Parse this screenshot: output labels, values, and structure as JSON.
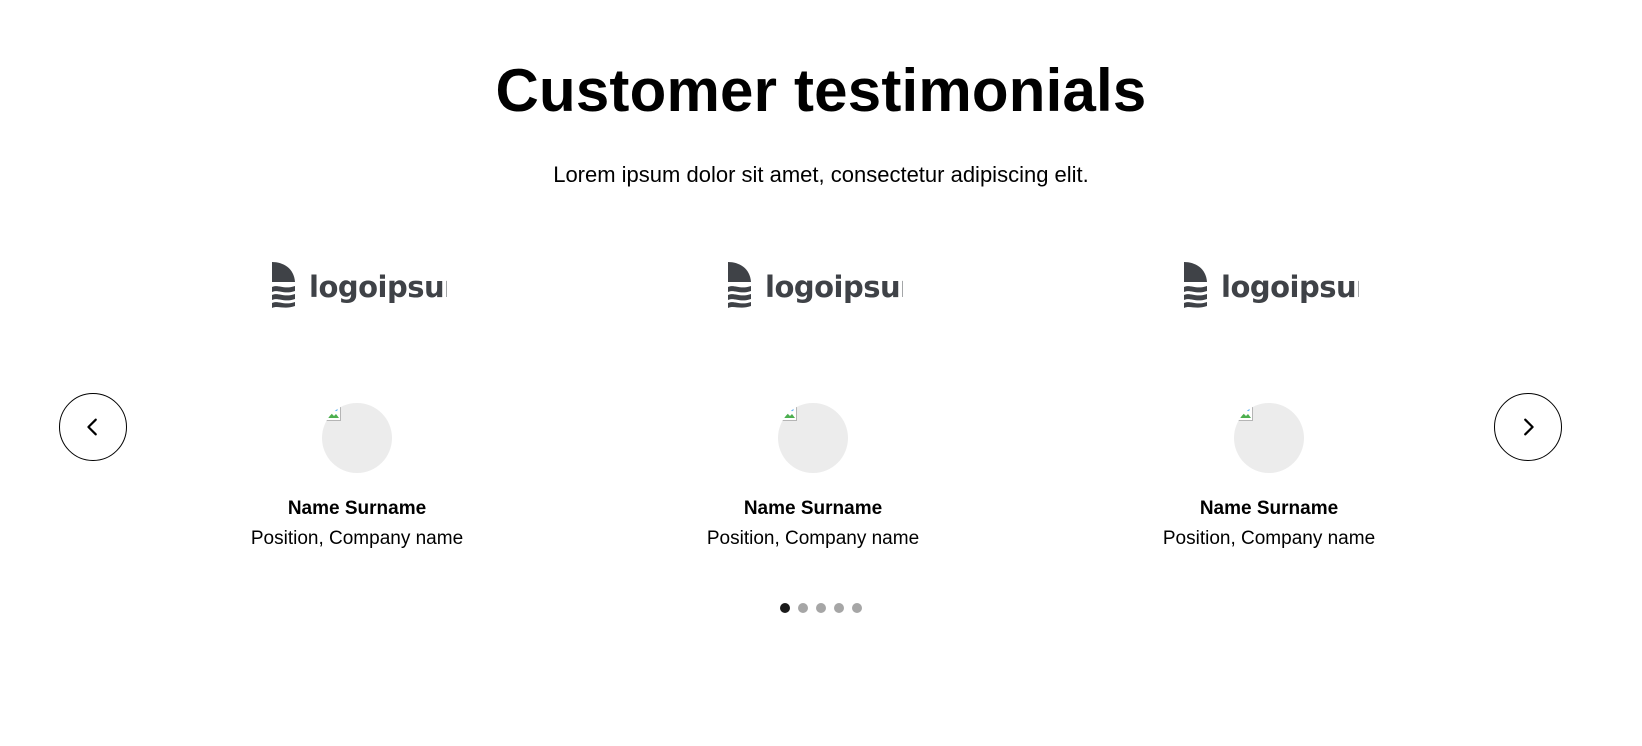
{
  "header": {
    "title": "Customer testimonials",
    "subtitle": "Lorem ipsum dolor sit amet, consectetur adipiscing elit."
  },
  "navigation": {
    "prev_icon": "chevron-left-icon",
    "next_icon": "chevron-right-icon"
  },
  "testimonials": [
    {
      "logo_text": "logoipsum",
      "logo_icon": "logo-mark-icon",
      "name": "Name Surname",
      "position": "Position, Company name"
    },
    {
      "logo_text": "logoipsum",
      "logo_icon": "logo-mark-icon",
      "name": "Name Surname",
      "position": "Position, Company name"
    },
    {
      "logo_text": "logoipsum",
      "logo_icon": "logo-mark-icon",
      "name": "Name Surname",
      "position": "Position, Company name"
    }
  ],
  "pagination": {
    "count": 5,
    "active_index": 0
  },
  "colors": {
    "logo": "#3f4247",
    "dot_active": "#1a1a1a",
    "dot_inactive": "#a6a6a6",
    "avatar_placeholder": "#ececec"
  }
}
